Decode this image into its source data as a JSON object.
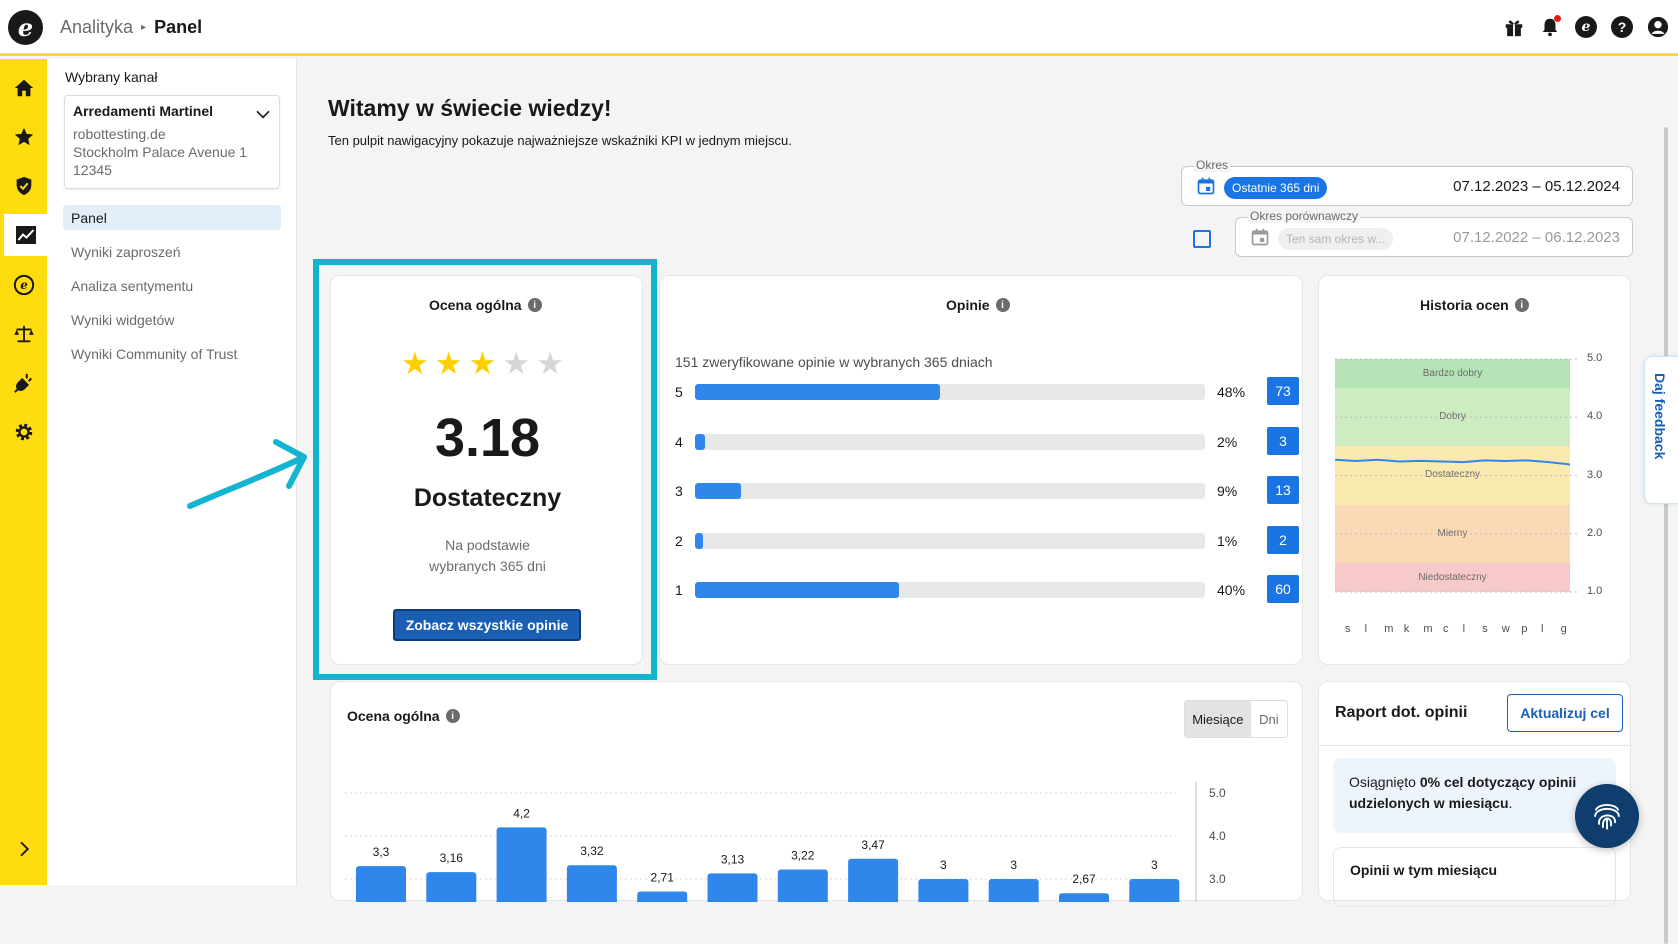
{
  "header": {
    "breadcrumb": [
      "Analityka",
      "Panel"
    ],
    "logo_letter": "e",
    "icons": [
      "gift-icon",
      "bell-icon",
      "trusted-shops-icon",
      "help-icon",
      "account-icon"
    ]
  },
  "rail": {
    "items": [
      "home-icon",
      "star-icon",
      "shield-icon",
      "analytics-icon",
      "trusted-shops-icon",
      "scales-icon",
      "plug-icon",
      "gear-icon"
    ],
    "active": "analytics-icon"
  },
  "sidebar": {
    "label": "Wybrany kanał",
    "channel": {
      "name": "Arredamenti Martinel",
      "line1": "robottesting.de",
      "line2": "Stockholm Palace Avenue 1",
      "line3": "12345"
    },
    "nav": [
      "Panel",
      "Wyniki zaproszeń",
      "Analiza sentymentu",
      "Wyniki widgetów",
      "Wyniki Community of Trust"
    ],
    "active_nav": "Panel"
  },
  "main": {
    "title": "Witamy w świecie wiedzy!",
    "subtitle": "Ten pulpit nawigacyjny pokazuje najważniejsze wskaźniki KPI w jednym miejscu.",
    "period": {
      "label": "Okres",
      "chip": "Ostatnie 365 dni",
      "dates": "07.12.2023 – 05.12.2024"
    },
    "comparison": {
      "label": "Okres porównawczy",
      "chip": "Ten sam okres w...",
      "dates": "07.12.2022 – 06.12.2023",
      "checked": false
    }
  },
  "overall": {
    "title": "Ocena ogólna",
    "stars_filled": 3,
    "stars_total": 5,
    "score": "3.18",
    "rating_word": "Dostateczny",
    "based_line1": "Na podstawie",
    "based_line2": "wybranych 365 dni",
    "button": "Zobacz wszystkie opinie"
  },
  "reviews": {
    "title": "Opinie",
    "summary": "151 zweryfikowane opinie w wybranych 365 dniach",
    "rows": [
      {
        "stars": "5",
        "percent": 48,
        "percent_label": "48%",
        "count": "73"
      },
      {
        "stars": "4",
        "percent": 2,
        "percent_label": "2%",
        "count": "3"
      },
      {
        "stars": "3",
        "percent": 9,
        "percent_label": "9%",
        "count": "13"
      },
      {
        "stars": "2",
        "percent": 1,
        "percent_label": "1%",
        "count": "2"
      },
      {
        "stars": "1",
        "percent": 40,
        "percent_label": "40%",
        "count": "60"
      }
    ]
  },
  "history": {
    "title": "Historia ocen",
    "bands": [
      "Bardzo dobry",
      "Dobry",
      "Dostateczny",
      "Mierny",
      "Niedostateczny"
    ],
    "y_ticks": [
      "5.0",
      "4.0",
      "3.0",
      "2.0",
      "1.0"
    ],
    "x_ticks": [
      "s",
      "l",
      "m",
      "k",
      "m",
      "c",
      "l",
      "s",
      "w",
      "p",
      "l",
      "g"
    ]
  },
  "feedback_tab": "Daj feedback",
  "monthly": {
    "title": "Ocena ogólna",
    "toggle": [
      "Miesiące",
      "Dni"
    ],
    "active_toggle": "Miesiące",
    "y_ticks": [
      "5.0",
      "4.0",
      "3.0"
    ]
  },
  "report": {
    "title": "Raport dot. opinii",
    "button": "Aktualizuj cel",
    "goal_prefix": "Osiągnięto ",
    "goal_bold": "0% cel dotyczący opinii udzielonych w miesiącu",
    "goal_suffix": ".",
    "month_title": "Opinii w tym miesiącu"
  },
  "colors": {
    "brand_yellow": "#ffdc0f",
    "primary_blue": "#1b74e4",
    "highlight_cyan": "#12b5cf"
  },
  "chart_data": [
    {
      "type": "bar",
      "title": "Ocena ogólna",
      "categories": [
        "",
        "",
        "",
        "",
        "",
        "",
        "",
        "",
        "",
        "",
        "",
        ""
      ],
      "values": [
        3.3,
        3.16,
        4.2,
        3.32,
        2.71,
        3.13,
        3.22,
        3.47,
        3,
        3,
        2.67,
        3
      ],
      "value_labels": [
        "3,3",
        "3,16",
        "4,2",
        "3,32",
        "2,71",
        "3,13",
        "3,22",
        "3,47",
        "3",
        "3",
        "2,67",
        "3"
      ],
      "ylim": [
        1,
        5
      ],
      "grid": true
    },
    {
      "type": "line",
      "title": "Historia ocen",
      "x": [
        "s",
        "l",
        "m",
        "k",
        "m",
        "c",
        "l",
        "s",
        "w",
        "p",
        "l",
        "g"
      ],
      "values": [
        3.27,
        3.25,
        3.27,
        3.24,
        3.25,
        3.24,
        3.23,
        3.26,
        3.25,
        3.26,
        3.23,
        3.19
      ],
      "ylim": [
        1,
        5
      ],
      "bands": [
        {
          "name": "Bardzo dobry",
          "from": 4.5,
          "to": 5.0
        },
        {
          "name": "Dobry",
          "from": 3.5,
          "to": 4.5
        },
        {
          "name": "Dostateczny",
          "from": 2.5,
          "to": 3.5
        },
        {
          "name": "Mierny",
          "from": 1.5,
          "to": 2.5
        },
        {
          "name": "Niedostateczny",
          "from": 1.0,
          "to": 1.5
        }
      ]
    }
  ]
}
